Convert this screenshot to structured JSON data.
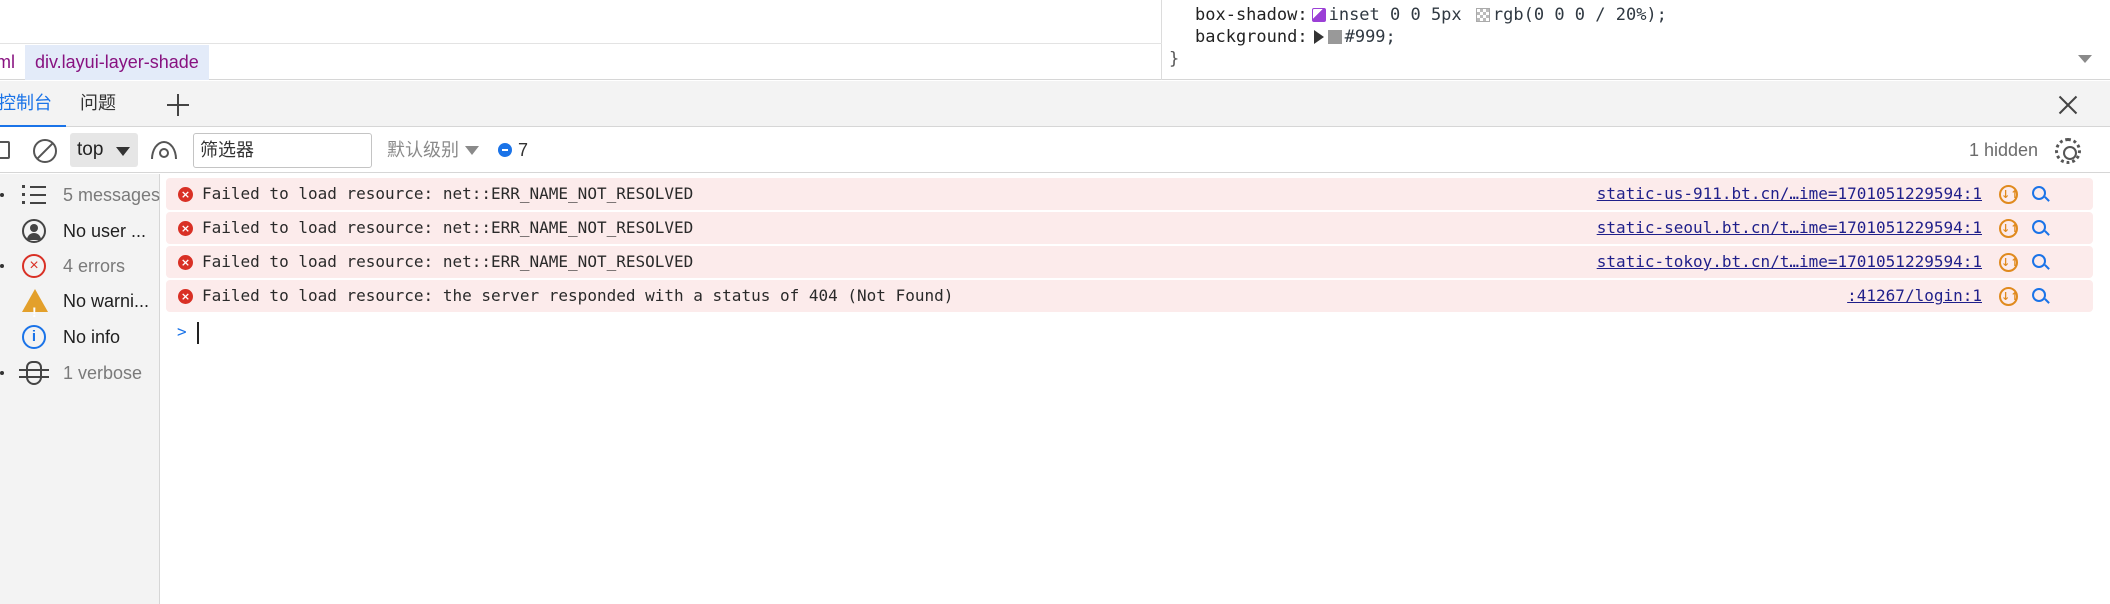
{
  "breadcrumb": {
    "items": [
      "ml",
      "div.layui-layer-shade"
    ]
  },
  "styles": {
    "box_shadow_prop": "box-shadow:",
    "box_shadow_inset": "inset 0 0 5px",
    "box_shadow_color": "rgb(0 0 0 / 20%);",
    "background_prop": "background:",
    "background_value": "#999;",
    "closing_brace": "}"
  },
  "drawer": {
    "tabs": [
      {
        "label": "控制台",
        "active": true
      },
      {
        "label": "问题",
        "active": false
      }
    ]
  },
  "toolbar": {
    "context": "top",
    "filter_placeholder": "筛选器",
    "levels_label": "默认级别",
    "issues_count": "7",
    "hidden_label": "1 hidden"
  },
  "sidebar": {
    "items": [
      {
        "label": "5 messages",
        "icon": "list-icon",
        "muted": true
      },
      {
        "label": "No user ...",
        "icon": "user-icon",
        "muted": false
      },
      {
        "label": "4 errors",
        "icon": "error-icon",
        "muted": true
      },
      {
        "label": "No warni...",
        "icon": "warning-icon",
        "muted": false
      },
      {
        "label": "No info",
        "icon": "info-icon",
        "muted": false
      },
      {
        "label": "1 verbose",
        "icon": "bug-icon",
        "muted": true
      }
    ]
  },
  "messages": [
    {
      "text": "Failed to load resource: net::ERR_NAME_NOT_RESOLVED",
      "source": "static-us-911.bt.cn/…ime=1701051229594:1"
    },
    {
      "text": "Failed to load resource: net::ERR_NAME_NOT_RESOLVED",
      "source": "static-seoul.bt.cn/t…ime=1701051229594:1"
    },
    {
      "text": "Failed to load resource: net::ERR_NAME_NOT_RESOLVED",
      "source": "static-tokoy.bt.cn/t…ime=1701051229594:1"
    },
    {
      "text": "Failed to load resource: the server responded with a status of 404 (Not Found)",
      "source": ":41267/login:1"
    }
  ],
  "colors": {
    "accent": "#1a73e8",
    "error": "#d93025",
    "error_row_bg": "#fcebeb"
  }
}
